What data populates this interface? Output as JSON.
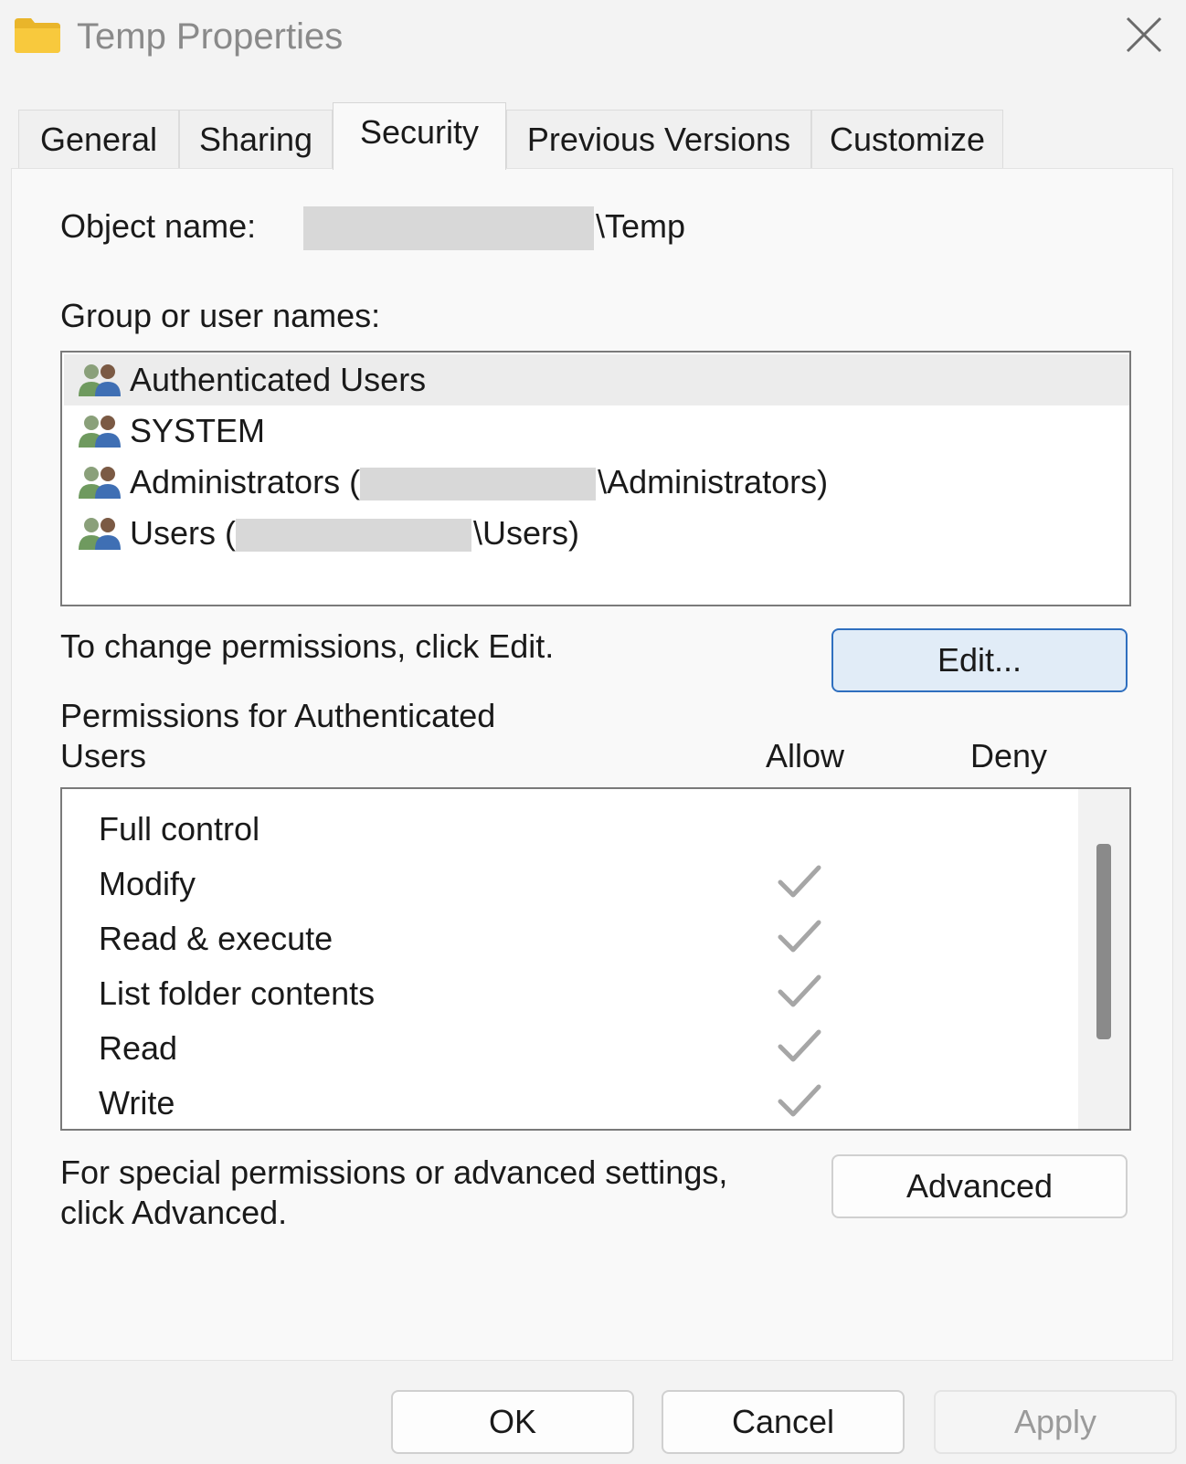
{
  "window": {
    "title": "Temp Properties"
  },
  "tabs": [
    {
      "label": "General",
      "active": false
    },
    {
      "label": "Sharing",
      "active": false
    },
    {
      "label": "Security",
      "active": true
    },
    {
      "label": "Previous Versions",
      "active": false
    },
    {
      "label": "Customize",
      "active": false
    }
  ],
  "object": {
    "label": "Object name:",
    "value_suffix": "\\Temp"
  },
  "groups": {
    "label": "Group or user names:",
    "items": [
      {
        "prefix": "Authenticated Users",
        "suffix": "",
        "selected": true
      },
      {
        "prefix": "SYSTEM",
        "suffix": "",
        "selected": false
      },
      {
        "prefix": "Administrators (",
        "suffix": "\\Administrators)",
        "selected": false
      },
      {
        "prefix": "Users (",
        "suffix": "\\Users)",
        "selected": false
      }
    ]
  },
  "edit": {
    "hint": "To change permissions, click Edit.",
    "button": "Edit..."
  },
  "permissions": {
    "title_line1": "Permissions for Authenticated",
    "title_line2": "Users",
    "allow_header": "Allow",
    "deny_header": "Deny",
    "rows": [
      {
        "name": "Full control",
        "allow": false,
        "deny": false
      },
      {
        "name": "Modify",
        "allow": true,
        "deny": false
      },
      {
        "name": "Read & execute",
        "allow": true,
        "deny": false
      },
      {
        "name": "List folder contents",
        "allow": true,
        "deny": false
      },
      {
        "name": "Read",
        "allow": true,
        "deny": false
      },
      {
        "name": "Write",
        "allow": true,
        "deny": false
      }
    ]
  },
  "advanced": {
    "hint_line1": "For special permissions or advanced settings,",
    "hint_line2": "click Advanced.",
    "button": "Advanced"
  },
  "footer": {
    "ok": "OK",
    "cancel": "Cancel",
    "apply": "Apply"
  },
  "colors": {
    "accent": "#2f6fbf",
    "accent_bg": "#e1ecf7",
    "check": "#a6a6a6",
    "folder": "#f8c93d"
  }
}
